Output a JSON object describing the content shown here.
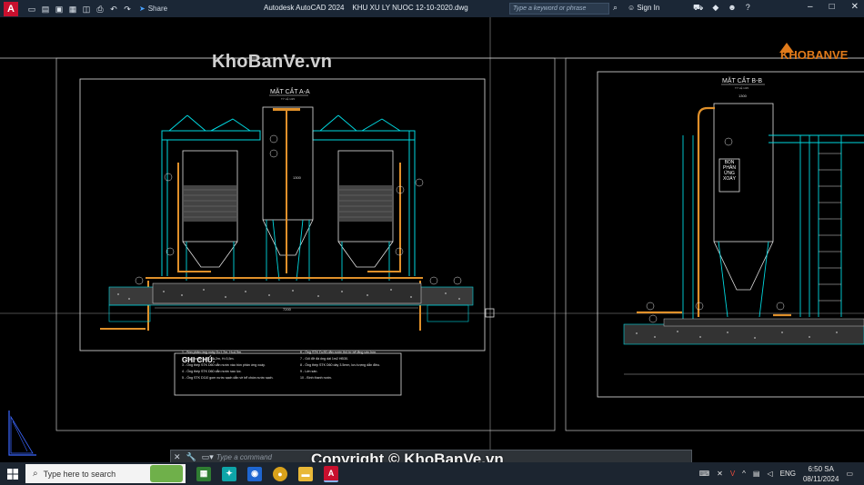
{
  "titlebar": {
    "app_letter": "A",
    "share_label": "Share",
    "title": "Autodesk AutoCAD 2024    KHU XU LY NUOC 12-10-2020.dwg",
    "search_placeholder": "Type a keyword or phrase",
    "signin_label": "Sign In"
  },
  "watermark": {
    "text": "KhoBanVe.vn",
    "logo_text": "KHOBANVE",
    "copyright": "Copyright © KhoBanVe.vn"
  },
  "drawing": {
    "section_aa_title": "MẶT CẮT A-A",
    "section_bb_title": "MẶT CẮT B-B",
    "scale_label": "TỶ LỆ 1/25",
    "dim_1300": "1300",
    "dim_7200": "7200",
    "tank_label": "BỒN PHẢN ỨNG XOÁY",
    "notes_title": "GHI CHÚ:",
    "notes_left": [
      "1 - Bồn phản ứng xoáy D=1,2m, H=4,5m.",
      "2 - Bồn lọc áp lực D=1,2m, H=3,5m.",
      "3 - Ống thép STK D60 dẫn nước vào bồn phản ứng xoáy.",
      "4 - Ống thép STK D60 dẫn nước sau lọc.",
      "5 - Ống STK D110 gom nước sạch dẫn về bể chứa nước sạch."
    ],
    "notes_right": [
      "6 - Ống STK D=90 dẫn nước thô từ bể lắng vào bồn.",
      "7 - Gối đỡ đá ống dài 1m2 HĐ30.",
      "8 - Ống thép STK D60 dày 3.5mm, lưu lượng dẫn điều.",
      "9 - Lớn sàn.",
      "10 - Bình thanh nước."
    ]
  },
  "command": {
    "placeholder": "Type a command"
  },
  "taskbar": {
    "search_placeholder": "Type here to search",
    "lang": "ENG",
    "time": "6:50 SA",
    "date": "08/11/2024"
  },
  "colors": {
    "cyan": "#00d8e0",
    "green": "#2fd06a",
    "orange": "#e0902a",
    "autocad_red": "#c8102e"
  }
}
